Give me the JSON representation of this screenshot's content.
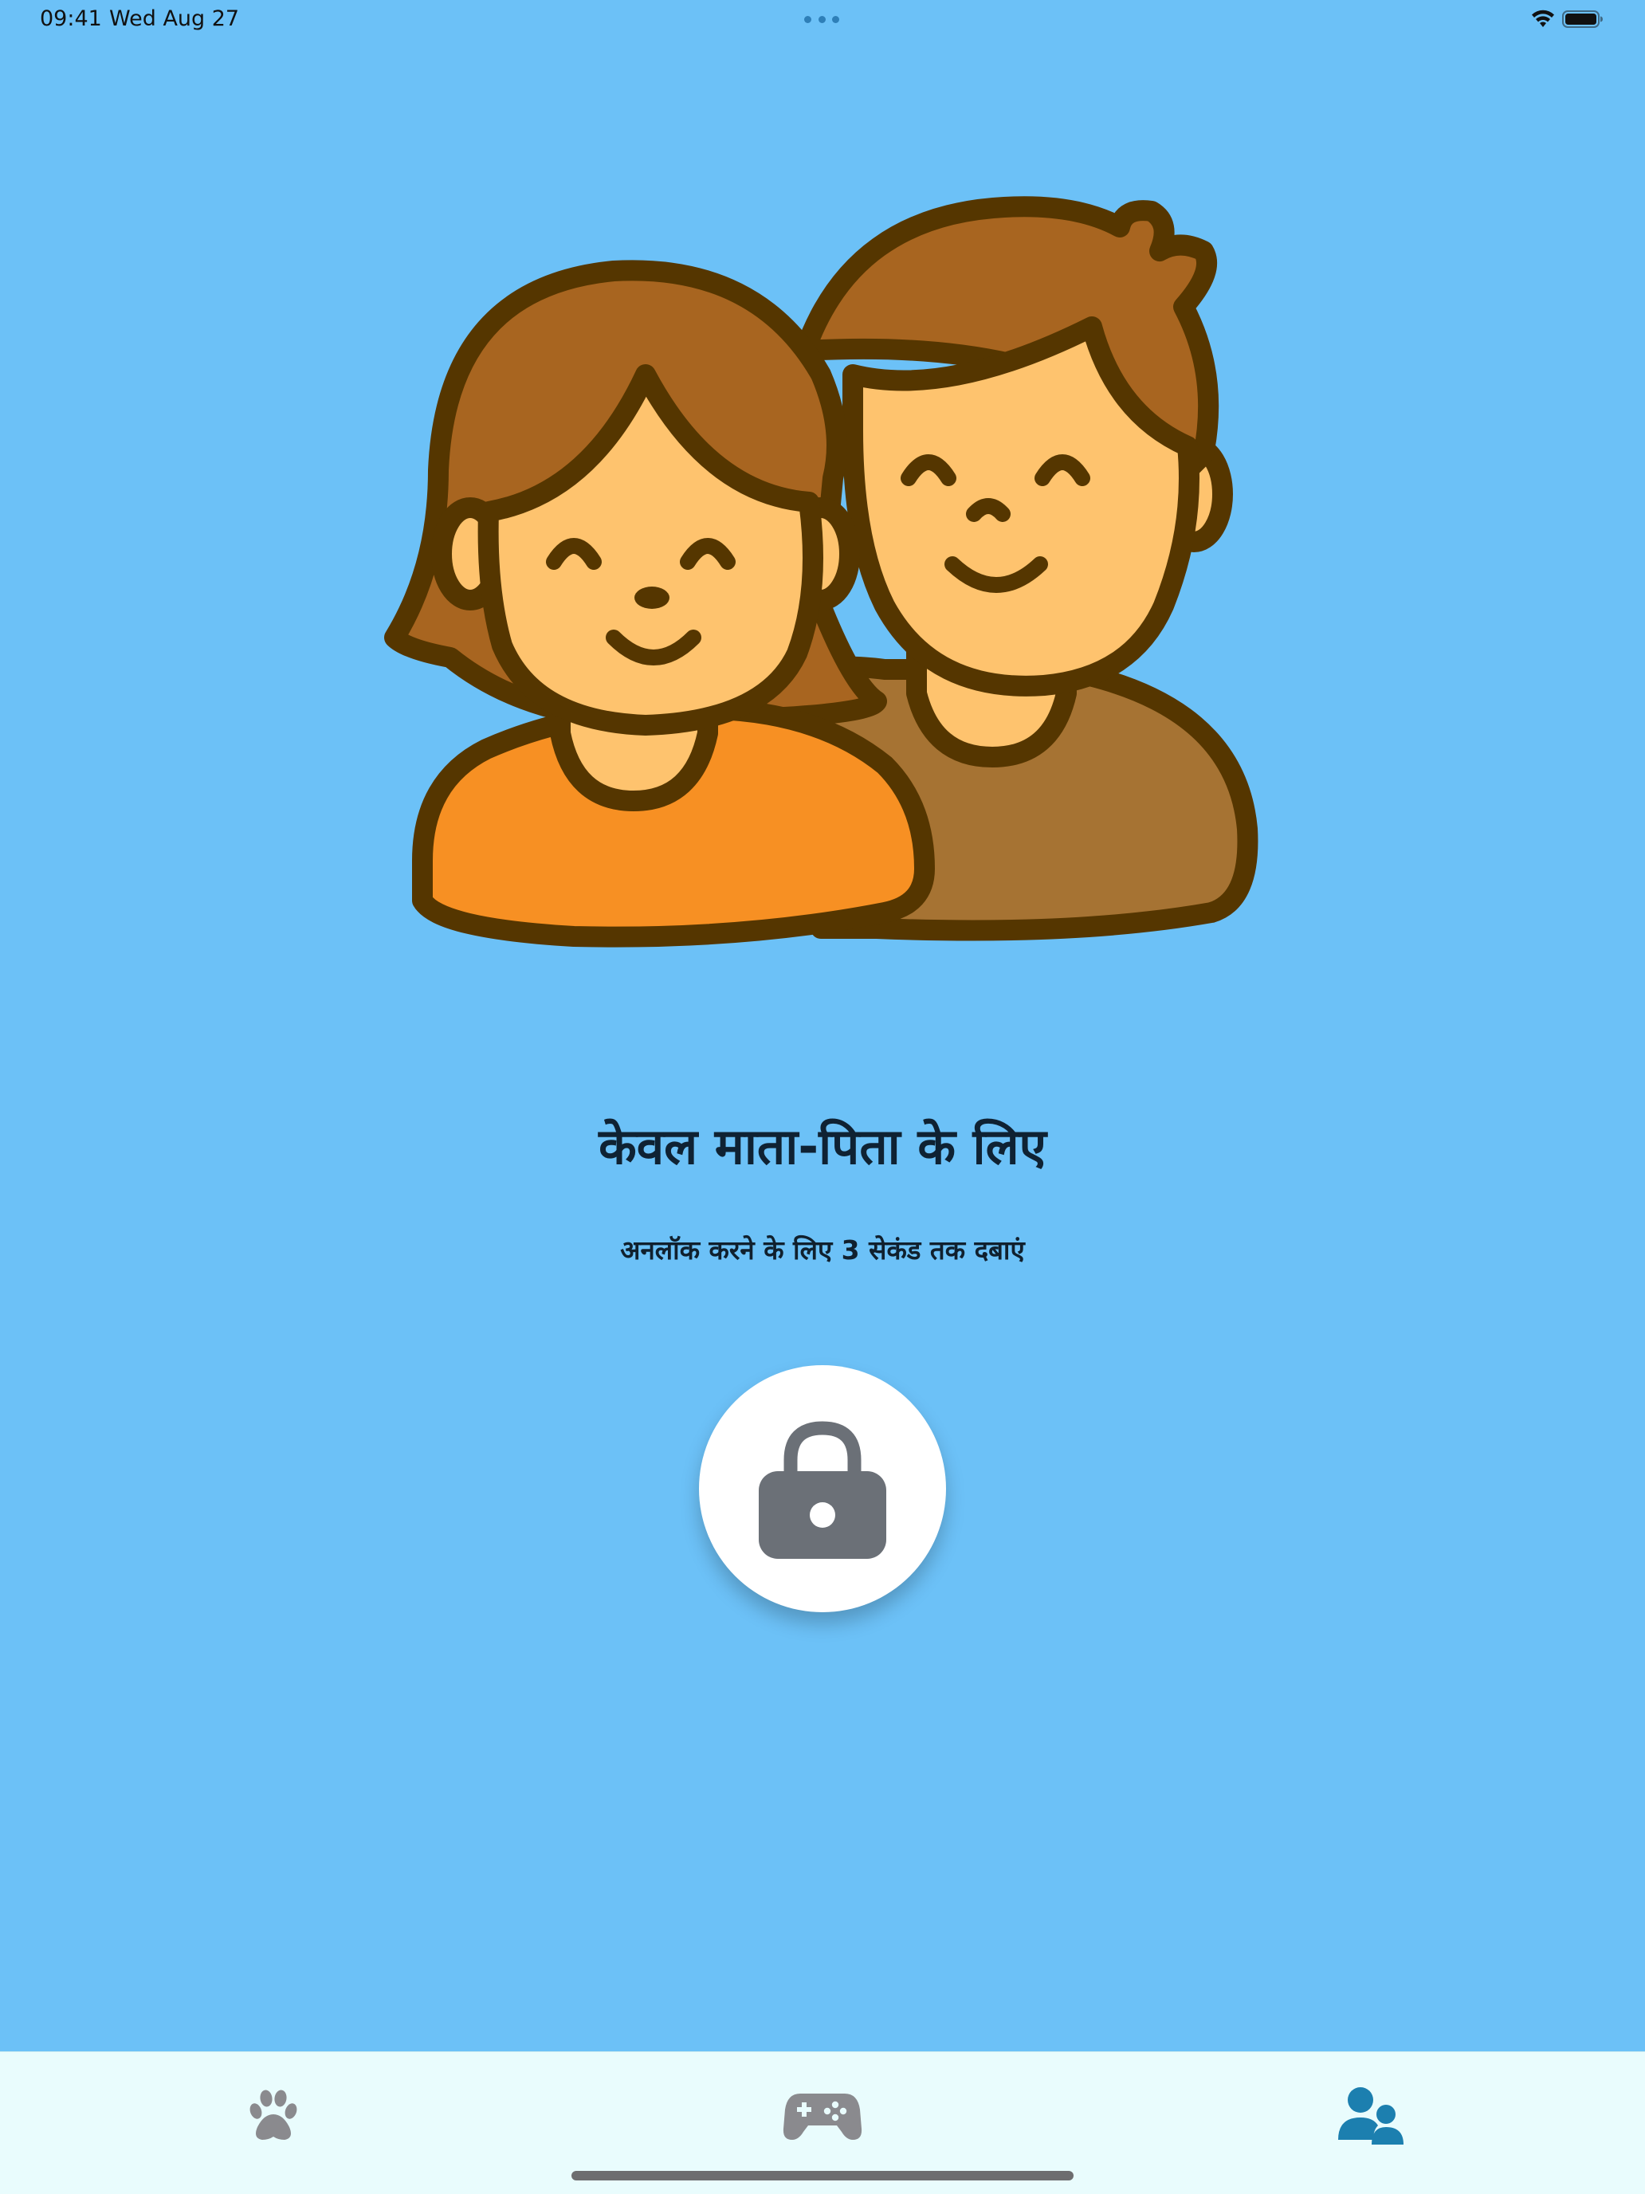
{
  "status_bar": {
    "time": "09:41",
    "date": "Wed Aug 27",
    "icons": [
      "wifi-icon",
      "battery-icon"
    ]
  },
  "main": {
    "illustration": "parents-illustration",
    "title": "केवल माता-पिता के लिए",
    "subtitle": "अनलॉक करने के लिए 3 सेकंड तक दबाएं",
    "lock_button": {
      "icon": "lock-icon"
    }
  },
  "tab_bar": {
    "tabs": [
      {
        "name": "pets",
        "icon": "paw-icon",
        "selected": false
      },
      {
        "name": "games",
        "icon": "gamepad-icon",
        "selected": false
      },
      {
        "name": "parents",
        "icon": "users-icon",
        "selected": true
      }
    ]
  },
  "colors": {
    "background": "#6CC1F7",
    "tab_bar_background": "#E9FCFD",
    "inactive_tab_icon": "#8A8A8E",
    "active_tab_icon": "#1C7FAF",
    "lock_icon": "#6B7077",
    "outline_brown": "#553600",
    "hair_brown": "#A86520",
    "skin": "#FEC36E",
    "orange_shirt": "#F79023",
    "brown_shirt": "#A67333"
  }
}
